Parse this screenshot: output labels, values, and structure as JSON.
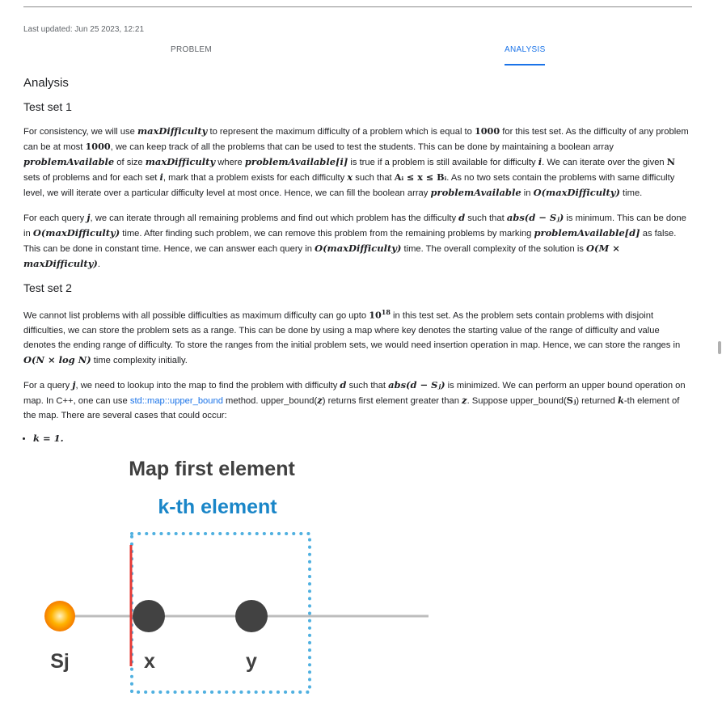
{
  "header": {
    "last_updated": "Last updated: Jun 25 2023, 12:21"
  },
  "tabs": [
    {
      "label": "PROBLEM"
    },
    {
      "label": "ANALYSIS"
    }
  ],
  "analysis": {
    "title": "Analysis",
    "test_set_1": {
      "heading": "Test set 1",
      "p1": {
        "a": "For consistency, we will use ",
        "m1": "maxDifficulty",
        "b": " to represent the maximum difficulty of a problem which is equal to ",
        "n1": "1000",
        "c": " for this test set. As the difficulty of any problem can be at most ",
        "n2": "1000",
        "d": ", we can keep track of all the problems that can be used to test the students. This can be done by maintaining a boolean array ",
        "m2": "problemAvailable",
        "e": " of size ",
        "m3": "maxDifficulty",
        "f": " where ",
        "m4": "problemAvailable[i]",
        "g": " is true if a problem is still available for difficulty ",
        "m5": "i",
        "h": ". We can iterate over the given ",
        "m6": "N",
        "i": " sets of problems and for each set ",
        "m7": "i",
        "j": ", mark that a problem exists for each difficulty ",
        "m8": "x",
        "k": " such that ",
        "m9": "Aᵢ ≤ x ≤ Bᵢ",
        "l": ". As no two sets contain the problems with same difficulty level, we will iterate over a particular difficulty level at most once. Hence, we can fill the boolean array ",
        "m10": "problemAvailable",
        "m": " in ",
        "m11": "O(maxDifficulty)",
        "n": " time."
      },
      "p2": {
        "a": "For each query ",
        "m1": "j",
        "b": ", we can iterate through all remaining problems and find out which problem has the difficulty ",
        "m2": "d",
        "c": " such that ",
        "m3": "abs(d − Sⱼ)",
        "d": " is minimum. This can be done in ",
        "m4": "O(maxDifficulty)",
        "e": " time. After finding such problem, we can remove this problem from the remaining problems by marking ",
        "m5": "problemAvailable[d]",
        "f": " as false. This can be done in constant time. Hence, we can answer each query in ",
        "m6": "O(maxDifficulty)",
        "g": " time. The overall complexity of the solution is ",
        "m7": "O(M × maxDifficulty)",
        "h": "."
      }
    },
    "test_set_2": {
      "heading": "Test set 2",
      "p1": {
        "a": "We cannot list problems with all possible difficulties as maximum difficulty can go upto ",
        "m1": "10",
        "m1_sup": "18",
        "b": " in this test set. As the problem sets contain problems with disjoint difficulties, we can store the problem sets as a range. This can be done by using a map where key denotes the starting value of the range of difficulty and value denotes the ending range of difficulty. To store the ranges from the initial problem sets, we would need insertion operation in map. Hence, we can store the ranges in ",
        "m2": "O(N × log N)",
        "c": " time complexity initially."
      },
      "p2": {
        "a": "For a query ",
        "m1": "j",
        "b": ", we need to lookup into the map to find the problem with difficulty ",
        "m2": "d",
        "c": " such that ",
        "m3": "abs(d − Sⱼ)",
        "d": " is minimized. We can perform an upper bound operation on map. In C++, one can use ",
        "link": "std::map::upper_bound",
        "e": " method. upper_bound(",
        "m4": "z",
        "f": ") returns first element greater than ",
        "m5": "z",
        "g": ". Suppose upper_bound(",
        "m6": "Sⱼ",
        "h": ") returned ",
        "m7": "k",
        "i": "-th element of the map. There are several cases that could occur:"
      },
      "bullet": "k = 1."
    }
  },
  "diagram": {
    "title": "Map first element",
    "subtitle": "k-th element",
    "labels": {
      "sj": "Sj",
      "x": "x",
      "y": "y"
    },
    "colors": {
      "title": "#404040",
      "subtitle": "#1a86c8",
      "red": "#e53935",
      "dot": "#424242",
      "orange": "#ff9800",
      "dotted": "#4fb0e0"
    }
  }
}
